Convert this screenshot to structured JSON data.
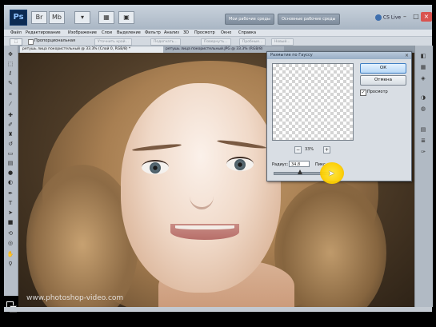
{
  "titlebar": {
    "app_logo": "Ps",
    "workspace_buttons": [
      "Мои рабочие среды",
      "Основные рабочие среды"
    ],
    "cs_live": "CS Live",
    "controls": {
      "minimize": "–",
      "maximize": "□",
      "close": "×"
    }
  },
  "menubar": {
    "items": [
      "Файл",
      "Редактирование",
      "Изображение",
      "Слои",
      "Выделение",
      "Фильтр",
      "Анализ",
      "3D",
      "Просмотр",
      "Окно",
      "Справка"
    ]
  },
  "options": {
    "checkbox_label": "Пропорциональная",
    "buttons": [
      "Уточнить край...",
      "Подогнать...",
      "Повернуть...",
      "Пробные...",
      "Новый..."
    ]
  },
  "tabs": [
    {
      "label": "ретушь лица покористельный @ 33.3% (Слой 0, RGB/8) *",
      "active": true
    },
    {
      "label": "ретушь лица покористельный.JPG @ 33.3% (RGB/8)",
      "active": false
    }
  ],
  "dialog": {
    "title": "Размытие по Гауссу",
    "ok_label": "ОК",
    "cancel_label": "Отмена",
    "preview_label": "Просмотр",
    "preview_checked": "✓",
    "zoom_value": "33%",
    "zoom_minus": "−",
    "zoom_plus": "+",
    "radius_label": "Радиус:",
    "radius_value": "34,8",
    "radius_unit": "Пикс.",
    "radius_slider_fraction": 0.46
  },
  "canvas": {
    "watermark": "www.photoshop-video.com"
  },
  "icons": {
    "left_tools": [
      "move-icon",
      "marquee-icon",
      "lasso-icon",
      "quick-select-icon",
      "crop-icon",
      "eyedropper-icon",
      "healing-icon",
      "brush-icon",
      "clone-stamp-icon",
      "history-brush-icon",
      "eraser-icon",
      "gradient-icon",
      "blur-icon",
      "dodge-icon",
      "pen-icon",
      "type-icon",
      "path-select-icon",
      "shape-icon",
      "3d-rotate-icon",
      "3d-orbit-icon",
      "hand-icon",
      "zoom-icon"
    ],
    "right_panels": [
      "color-panel-icon",
      "swatches-icon",
      "styles-icon",
      "adjustments-icon",
      "masks-icon",
      "layers-icon",
      "channels-icon",
      "paths-icon"
    ]
  }
}
